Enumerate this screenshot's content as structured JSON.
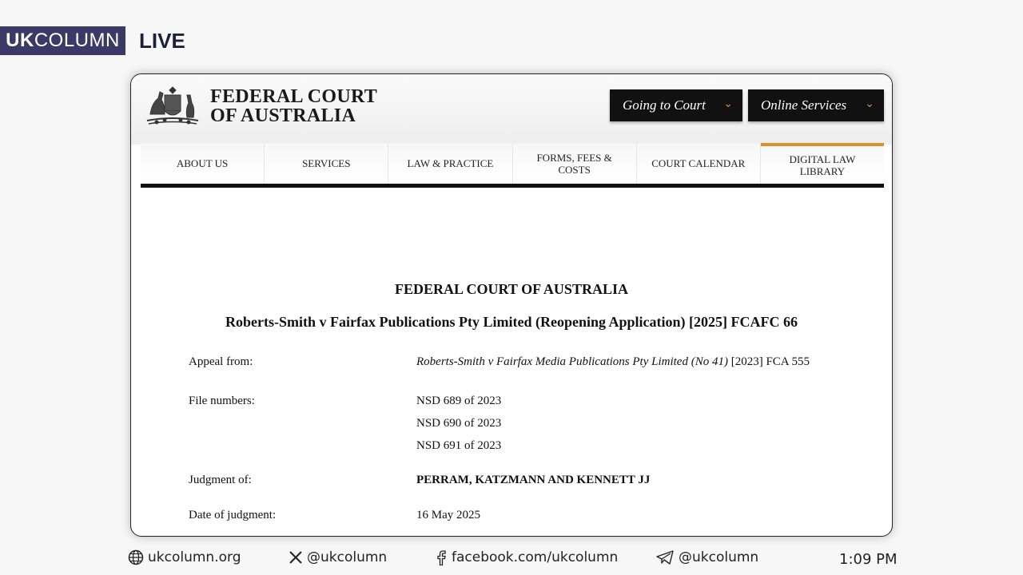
{
  "broadcast": {
    "brand_uk": "UK",
    "brand_column": "COLUMN",
    "live": "LIVE",
    "colors": {
      "brand_bg": "#3b3a66",
      "accent_orange": "#d9912e"
    }
  },
  "site": {
    "court_name_line1": "FEDERAL COURT",
    "court_name_line2": "OF AUSTRALIA",
    "header_buttons": [
      {
        "label": "Going to Court",
        "icon": "chevron-down-icon"
      },
      {
        "label": "Online Services",
        "icon": "chevron-down-icon"
      }
    ],
    "nav": [
      {
        "label": "ABOUT US"
      },
      {
        "label": "SERVICES"
      },
      {
        "label": "LAW & PRACTICE"
      },
      {
        "label": "FORMS, FEES & COSTS"
      },
      {
        "label": "COURT CALENDAR"
      },
      {
        "label": "DIGITAL LAW LIBRARY",
        "active": true
      }
    ]
  },
  "document": {
    "court_title": "FEDERAL COURT OF AUSTRALIA",
    "case_title": "Roberts-Smith v Fairfax Publications Pty Limited (Reopening Application) [2025] FCAFC 66",
    "appeal_from_label": "Appeal from:",
    "appeal_from_case": "Roberts-Smith v Fairfax Media Publications Pty Limited (No 41)",
    "appeal_from_citation": "[2023] FCA 555",
    "file_numbers_label": "File numbers:",
    "file_numbers": [
      "NSD 689 of 2023",
      "NSD 690 of 2023",
      "NSD 691 of 2023"
    ],
    "judgment_of_label": "Judgment of:",
    "judgment_of": "PERRAM, KATZMANN AND KENNETT JJ",
    "date_label": "Date of judgment:",
    "date": "16 May 2025"
  },
  "footer": {
    "website": "ukcolumn.org",
    "x_handle": "@ukcolumn",
    "facebook": "facebook.com/ukcolumn",
    "telegram": "@ukcolumn",
    "time": "1:09 PM"
  }
}
